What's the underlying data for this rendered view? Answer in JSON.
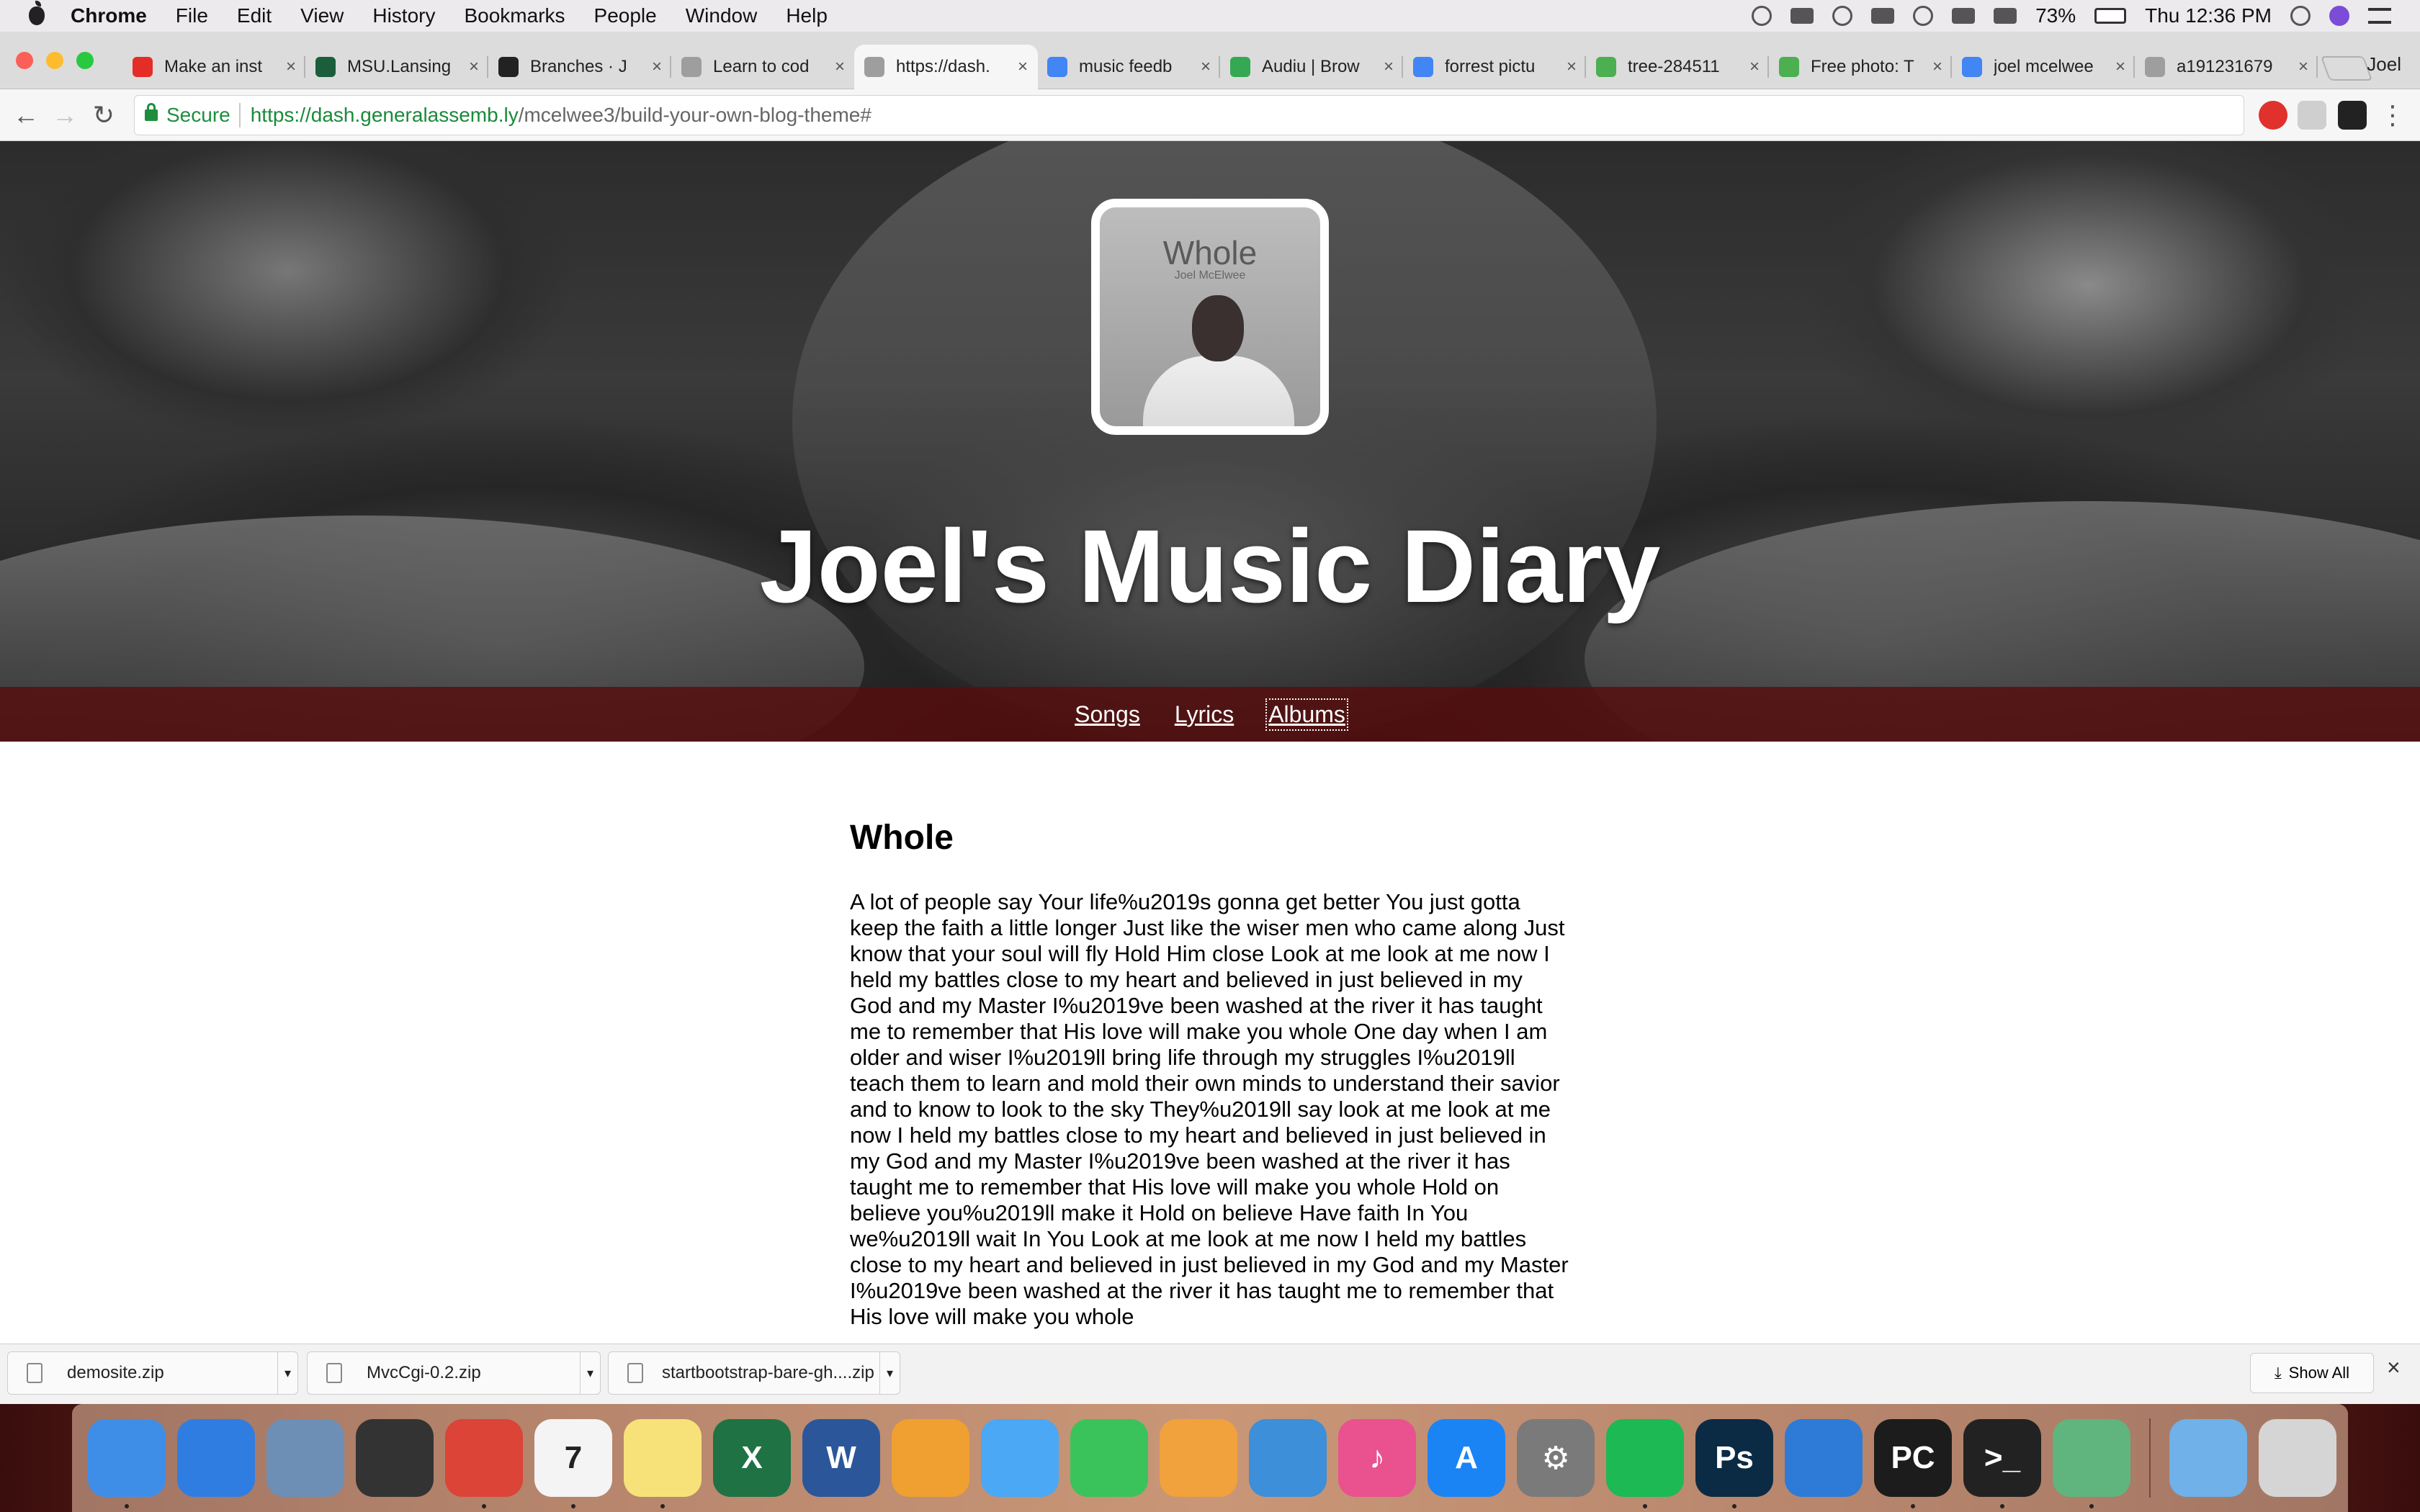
{
  "menubar": {
    "items": [
      "Chrome",
      "File",
      "Edit",
      "View",
      "History",
      "Bookmarks",
      "People",
      "Window",
      "Help"
    ],
    "battery": "73%",
    "clock": "Thu 12:36 PM"
  },
  "tabs": [
    {
      "title": "Make an inst",
      "favicon": "youtube-icon",
      "color": "#e52d27"
    },
    {
      "title": "MSU.Lansing",
      "favicon": "msu-icon",
      "color": "#1b5e3b"
    },
    {
      "title": "Branches · J",
      "favicon": "github-icon",
      "color": "#222222"
    },
    {
      "title": "Learn to cod",
      "favicon": "page-icon",
      "color": "#9e9e9e"
    },
    {
      "title": "https://dash.",
      "favicon": "page-icon",
      "color": "#9e9e9e"
    },
    {
      "title": "music feedb",
      "favicon": "google-icon",
      "color": "#4285f4"
    },
    {
      "title": "Audiu | Brow",
      "favicon": "audiu-icon",
      "color": "#34a853"
    },
    {
      "title": "forrest pictu",
      "favicon": "google-icon",
      "color": "#4285f4"
    },
    {
      "title": "tree-284511",
      "favicon": "pixabay-icon",
      "color": "#4caf50"
    },
    {
      "title": "Free photo: T",
      "favicon": "pixabay-icon",
      "color": "#4caf50"
    },
    {
      "title": "joel mcelwee",
      "favicon": "google-icon",
      "color": "#4285f4"
    },
    {
      "title": "a191231679",
      "favicon": "page-icon",
      "color": "#9e9e9e"
    }
  ],
  "profile": "Joel",
  "omnibox": {
    "secure_label": "Secure",
    "host": "https://dash.generalassemb.ly",
    "path": "/mcelwee3/build-your-own-blog-theme#"
  },
  "hero": {
    "album_title": "Whole",
    "album_artist": "Joel McElwee",
    "site_title": "Joel's Music Diary",
    "nav": [
      "Songs",
      "Lyrics",
      "Albums"
    ],
    "nav_color": "#580e0e"
  },
  "article": {
    "title": "Whole",
    "body": "A lot of people say Your life%u2019s gonna get better You just gotta keep the faith a little longer Just like the wiser men who came along Just know that your soul will fly Hold Him close Look at me look at me now I held my battles close to my heart and believed in just believed in my God and my Master I%u2019ve been washed at the river it has taught me to remember that His love will make you whole One day when I am older and wiser I%u2019ll bring life through my struggles I%u2019ll teach them to learn and mold their own minds to understand their savior and to know to look to the sky They%u2019ll say look at me look at me now I held my battles close to my heart and believed in just believed in my God and my Master I%u2019ve been washed at the river it has taught me to remember that His love will make you whole Hold on believe you%u2019ll make it Hold on believe Have faith In You we%u2019ll wait In You Look at me look at me now I held my battles close to my heart and believed in just believed in my God and my Master I%u2019ve been washed at the river it has taught me to remember that His love will make you whole"
  },
  "downloads": {
    "items": [
      "demosite.zip",
      "MvcCgi-0.2.zip",
      "startbootstrap-bare-gh....zip"
    ],
    "show_all": "Show All"
  },
  "dock": [
    {
      "name": "finder-icon",
      "color": "#3e8ee8",
      "glyph": "",
      "dot": true
    },
    {
      "name": "safari-icon",
      "color": "#2f7de1",
      "glyph": "",
      "dot": false
    },
    {
      "name": "mail-icon",
      "color": "#6d8fb5",
      "glyph": "",
      "dot": false
    },
    {
      "name": "logic-icon",
      "color": "#333333",
      "glyph": "",
      "dot": false
    },
    {
      "name": "chrome-icon",
      "color": "#db4437",
      "glyph": "",
      "dot": true
    },
    {
      "name": "calendar-icon",
      "color": "#f4f4f4",
      "glyph": "7",
      "dot": true
    },
    {
      "name": "notes-icon",
      "color": "#f7e27a",
      "glyph": "",
      "dot": true
    },
    {
      "name": "excel-icon",
      "color": "#1f7244",
      "glyph": "X",
      "dot": false
    },
    {
      "name": "word-icon",
      "color": "#2b579a",
      "glyph": "W",
      "dot": false
    },
    {
      "name": "photos-icon",
      "color": "#f0a030",
      "glyph": "",
      "dot": false
    },
    {
      "name": "messages-icon",
      "color": "#4aa8f5",
      "glyph": "",
      "dot": false
    },
    {
      "name": "facetime-icon",
      "color": "#3ac35a",
      "glyph": "",
      "dot": false
    },
    {
      "name": "pages-icon",
      "color": "#f2a23c",
      "glyph": "",
      "dot": false
    },
    {
      "name": "keynote-icon",
      "color": "#3c8fd8",
      "glyph": "",
      "dot": false
    },
    {
      "name": "itunes-icon",
      "color": "#e9518f",
      "glyph": "♪",
      "dot": false
    },
    {
      "name": "app-store-icon",
      "color": "#1a84f5",
      "glyph": "A",
      "dot": false
    },
    {
      "name": "system-preferences-icon",
      "color": "#7a7a7a",
      "glyph": "⚙",
      "dot": false
    },
    {
      "name": "spotify-icon",
      "color": "#1db954",
      "glyph": "",
      "dot": true
    },
    {
      "name": "photoshop-icon",
      "color": "#0b2a44",
      "glyph": "Ps",
      "dot": true
    },
    {
      "name": "xcode-icon",
      "color": "#2d7bd6",
      "glyph": "",
      "dot": false
    },
    {
      "name": "pycharm-icon",
      "color": "#1c1c1c",
      "glyph": "PC",
      "dot": true
    },
    {
      "name": "terminal-icon",
      "color": "#222222",
      "glyph": ">_",
      "dot": true
    },
    {
      "name": "atom-icon",
      "color": "#5fb57d",
      "glyph": "",
      "dot": true
    },
    {
      "name": "downloads-folder-icon",
      "color": "#6fb1e8",
      "glyph": "",
      "dot": false
    },
    {
      "name": "trash-icon",
      "color": "#d5d5d5",
      "glyph": "",
      "dot": false
    }
  ]
}
